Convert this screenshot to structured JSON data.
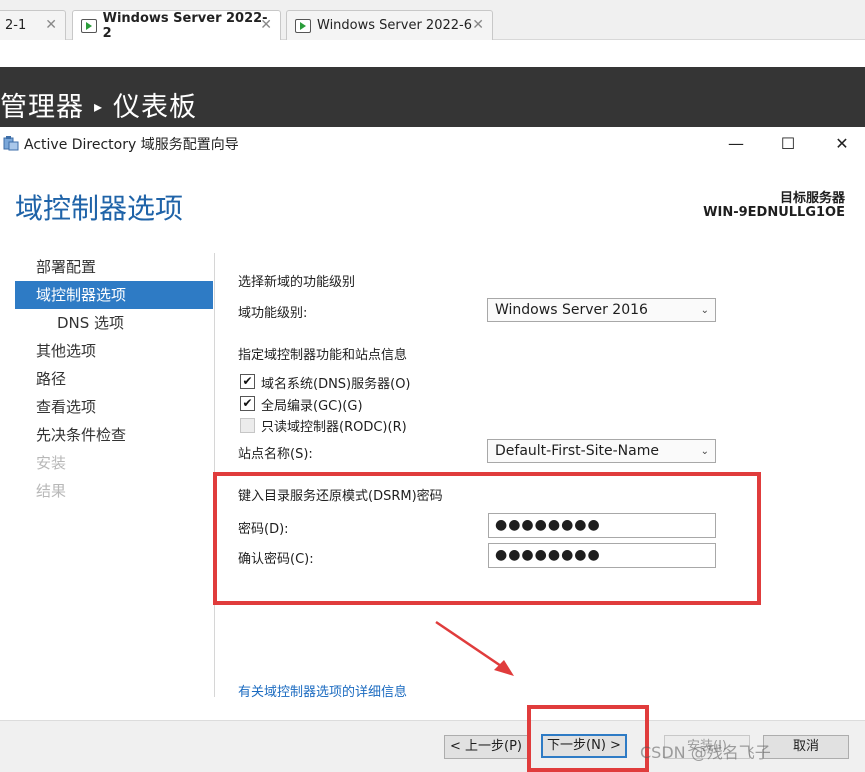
{
  "vm_tabs": [
    {
      "label": "2-1"
    },
    {
      "label": "Windows Server 2022-2"
    },
    {
      "label": "Windows Server 2022-6"
    }
  ],
  "server_manager": {
    "title_part1": "管理器",
    "separator": "▸",
    "title_part2": "仪表板"
  },
  "wizard": {
    "title": "Active Directory 域服务配置向导",
    "page_heading": "域控制器选项",
    "target_server_label": "目标服务器",
    "target_server_value": "WIN-9EDNULLG1OE",
    "nav": [
      {
        "label": "部署配置"
      },
      {
        "label": "域控制器选项"
      },
      {
        "label": "DNS 选项"
      },
      {
        "label": "其他选项"
      },
      {
        "label": "路径"
      },
      {
        "label": "查看选项"
      },
      {
        "label": "先决条件检查"
      },
      {
        "label": "安装"
      },
      {
        "label": "结果"
      }
    ],
    "section_functional": "选择新域的功能级别",
    "domain_level_label": "域功能级别:",
    "domain_level_value": "Windows Server 2016",
    "section_capabilities": "指定域控制器功能和站点信息",
    "cb_dns": "域名系统(DNS)服务器(O)",
    "cb_gc": "全局编录(GC)(G)",
    "cb_rodc": "只读域控制器(RODC)(R)",
    "site_label": "站点名称(S):",
    "site_value": "Default-First-Site-Name",
    "section_dsrm": "键入目录服务还原模式(DSRM)密码",
    "password_label": "密码(D):",
    "password_value": "●●●●●●●●",
    "confirm_label": "确认密码(C):",
    "confirm_value": "●●●●●●●●",
    "more_info_link": "有关域控制器选项的详细信息",
    "buttons": {
      "prev": "< 上一步(P)",
      "next": "下一步(N) >",
      "install": "安装(I)",
      "cancel": "取消"
    },
    "watermark": "CSDN @残名飞子"
  },
  "colors": {
    "accent": "#2e7bc5",
    "heading": "#1f63a8",
    "highlight_red": "#e03c3c",
    "header_dark": "#353535"
  }
}
